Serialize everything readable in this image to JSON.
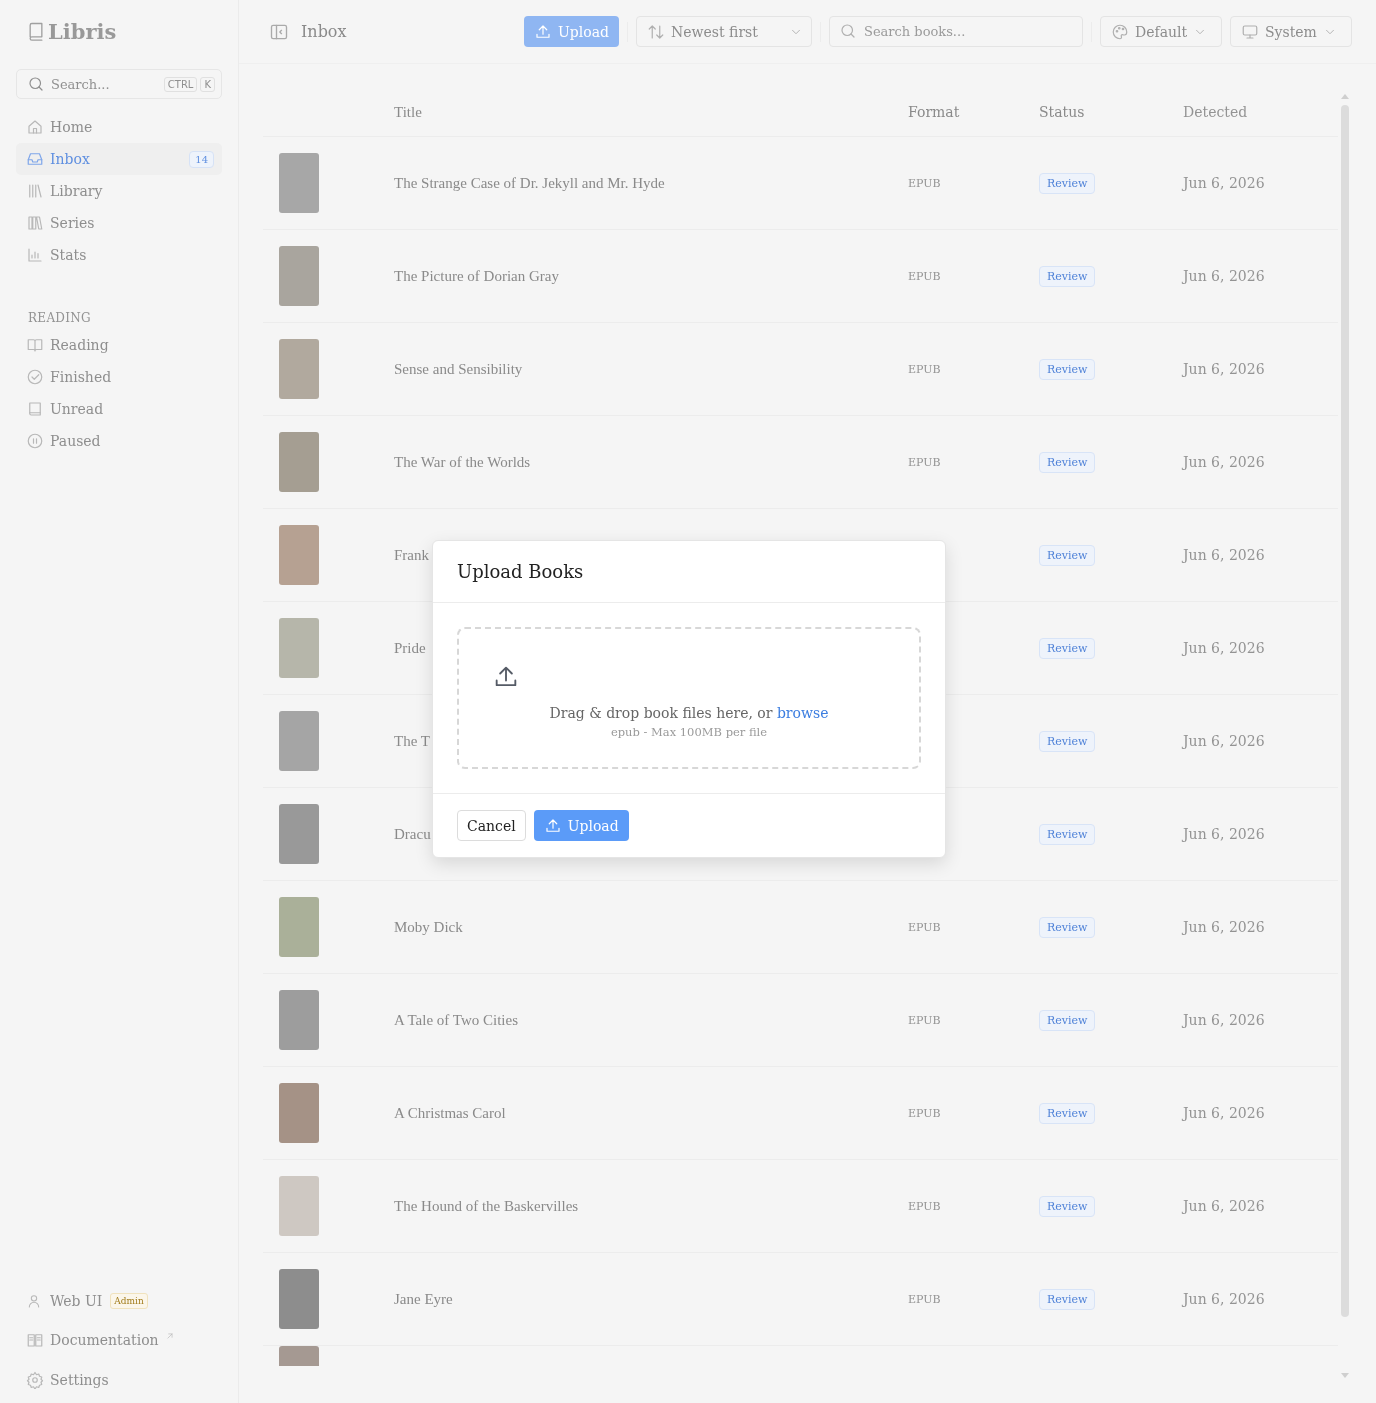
{
  "sidebar": {
    "brand": "Libris",
    "search": {
      "placeholder": "Search...",
      "keys": [
        "CTRL",
        "K"
      ]
    },
    "nav": [
      {
        "label": "Home",
        "selected": false
      },
      {
        "label": "Inbox",
        "selected": true,
        "badge": "14"
      },
      {
        "label": "Library",
        "selected": false
      },
      {
        "label": "Series",
        "selected": false
      },
      {
        "label": "Stats",
        "selected": false
      }
    ],
    "section_title": "READING",
    "reading": [
      {
        "label": "Reading",
        "selected": false
      },
      {
        "label": "Finished",
        "selected": false
      },
      {
        "label": "Unread",
        "selected": false
      },
      {
        "label": "Paused",
        "selected": false
      }
    ],
    "user": {
      "label": "Web UI",
      "role": "Admin"
    },
    "documentation": "Documentation",
    "settings": "Settings"
  },
  "topbar": {
    "title": "Inbox",
    "upload": "Upload",
    "sort": "Newest first",
    "search": {
      "placeholder": "Search books..."
    },
    "theme": "Default",
    "mode": "System"
  },
  "table": {
    "columns": [
      "Title",
      "Format",
      "Status",
      "Detected"
    ],
    "rows": [
      {
        "title": "The Strange Case of Dr. Jekyll and Mr. Hyde",
        "format": "EPUB",
        "status": "Review",
        "detected": "Jun 6, 2026"
      },
      {
        "title": "The Picture of Dorian Gray",
        "format": "EPUB",
        "status": "Review",
        "detected": "Jun 6, 2026"
      },
      {
        "title": "Sense and Sensibility",
        "format": "EPUB",
        "status": "Review",
        "detected": "Jun 6, 2026"
      },
      {
        "title": "The War of the Worlds",
        "format": "EPUB",
        "status": "Review",
        "detected": "Jun 6, 2026"
      },
      {
        "title": "Frank",
        "status": "Review",
        "detected": "Jun 6, 2026"
      },
      {
        "title": "Pride",
        "status": "Review",
        "detected": "Jun 6, 2026"
      },
      {
        "title": "The T",
        "status": "Review",
        "detected": "Jun 6, 2026"
      },
      {
        "title": "Dracu",
        "status": "Review",
        "detected": "Jun 6, 2026"
      },
      {
        "title": "Moby Dick",
        "format": "EPUB",
        "status": "Review",
        "detected": "Jun 6, 2026"
      },
      {
        "title": "A Tale of Two Cities",
        "format": "EPUB",
        "status": "Review",
        "detected": "Jun 6, 2026"
      },
      {
        "title": "A Christmas Carol",
        "format": "EPUB",
        "status": "Review",
        "detected": "Jun 6, 2026"
      },
      {
        "title": "The Hound of the Baskervilles",
        "format": "EPUB",
        "status": "Review",
        "detected": "Jun 6, 2026"
      },
      {
        "title": "Jane Eyre",
        "format": "EPUB",
        "status": "Review",
        "detected": "Jun 6, 2026"
      },
      {}
    ]
  },
  "modal": {
    "title": "Upload Books",
    "prompt": "Drag & drop book files here, or",
    "link": "browse",
    "hint": "epub - Max 100MB per file",
    "cancel": "Cancel",
    "upload": "Upload"
  }
}
